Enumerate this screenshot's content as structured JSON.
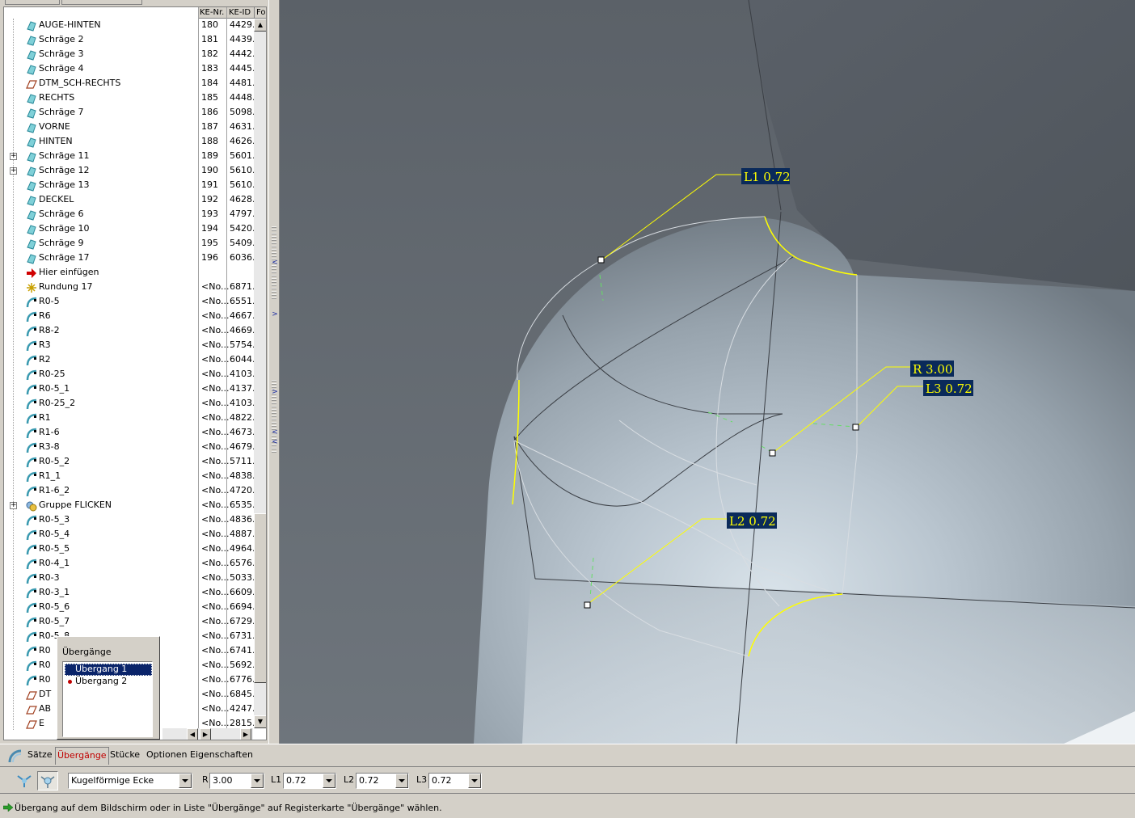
{
  "tree": {
    "columns": [
      "KE-Nr.",
      "KE-ID",
      "Fo"
    ],
    "rows": [
      {
        "label": "AUGE-HINTEN",
        "nr": "180",
        "id": "4429...",
        "icon": "extrude-icon",
        "expand": false
      },
      {
        "label": "Schräge 2",
        "nr": "181",
        "id": "4439...",
        "icon": "extrude-icon",
        "expand": false
      },
      {
        "label": "Schräge 3",
        "nr": "182",
        "id": "4442...",
        "icon": "extrude-icon",
        "expand": false
      },
      {
        "label": "Schräge 4",
        "nr": "183",
        "id": "4445...",
        "icon": "extrude-icon",
        "expand": false
      },
      {
        "label": "DTM_SCH-RECHTS",
        "nr": "184",
        "id": "4481...",
        "icon": "datum-plane-icon",
        "expand": false
      },
      {
        "label": "RECHTS",
        "nr": "185",
        "id": "4448...",
        "icon": "extrude-icon",
        "expand": false
      },
      {
        "label": "Schräge 7",
        "nr": "186",
        "id": "5098...",
        "icon": "extrude-icon",
        "expand": false
      },
      {
        "label": "VORNE",
        "nr": "187",
        "id": "4631...",
        "icon": "extrude-icon",
        "expand": false
      },
      {
        "label": "HINTEN",
        "nr": "188",
        "id": "4626...",
        "icon": "extrude-icon",
        "expand": false
      },
      {
        "label": "Schräge 11",
        "nr": "189",
        "id": "5601...",
        "icon": "extrude-icon",
        "expand": true
      },
      {
        "label": "Schräge 12",
        "nr": "190",
        "id": "5610...",
        "icon": "extrude-icon",
        "expand": true
      },
      {
        "label": "Schräge 13",
        "nr": "191",
        "id": "5610...",
        "icon": "extrude-icon",
        "expand": false
      },
      {
        "label": "DECKEL",
        "nr": "192",
        "id": "4628...",
        "icon": "extrude-icon",
        "expand": false
      },
      {
        "label": "Schräge 6",
        "nr": "193",
        "id": "4797...",
        "icon": "extrude-icon",
        "expand": false
      },
      {
        "label": "Schräge 10",
        "nr": "194",
        "id": "5420...",
        "icon": "extrude-icon",
        "expand": false
      },
      {
        "label": "Schräge 9",
        "nr": "195",
        "id": "5409...",
        "icon": "extrude-icon",
        "expand": false
      },
      {
        "label": "Schräge 17",
        "nr": "196",
        "id": "6036...",
        "icon": "extrude-icon",
        "expand": false
      },
      {
        "label": "Hier einfügen",
        "nr": "",
        "id": "",
        "icon": "insert-here-arrow-icon",
        "expand": false
      },
      {
        "label": "Rundung 17",
        "nr": "<No...",
        "id": "6871...",
        "icon": "active-round-icon",
        "expand": false
      },
      {
        "label": "R0-5",
        "nr": "<No...",
        "id": "6551...",
        "icon": "round-icon",
        "expand": false
      },
      {
        "label": "R6",
        "nr": "<No...",
        "id": "4667...",
        "icon": "round-icon",
        "expand": false
      },
      {
        "label": "R8-2",
        "nr": "<No...",
        "id": "4669...",
        "icon": "round-icon",
        "expand": false
      },
      {
        "label": "R3",
        "nr": "<No...",
        "id": "5754...",
        "icon": "round-icon",
        "expand": false
      },
      {
        "label": "R2",
        "nr": "<No...",
        "id": "6044...",
        "icon": "round-icon",
        "expand": false
      },
      {
        "label": "R0-25",
        "nr": "<No...",
        "id": "4103...",
        "icon": "round-icon",
        "expand": false
      },
      {
        "label": "R0-5_1",
        "nr": "<No...",
        "id": "4137...",
        "icon": "round-icon",
        "expand": false
      },
      {
        "label": "R0-25_2",
        "nr": "<No...",
        "id": "4103...",
        "icon": "round-icon",
        "expand": false
      },
      {
        "label": "R1",
        "nr": "<No...",
        "id": "4822...",
        "icon": "round-icon",
        "expand": false
      },
      {
        "label": "R1-6",
        "nr": "<No...",
        "id": "4673...",
        "icon": "round-icon",
        "expand": false
      },
      {
        "label": "R3-8",
        "nr": "<No...",
        "id": "4679...",
        "icon": "round-icon",
        "expand": false
      },
      {
        "label": "R0-5_2",
        "nr": "<No...",
        "id": "5711...",
        "icon": "round-icon",
        "expand": false
      },
      {
        "label": "R1_1",
        "nr": "<No...",
        "id": "4838...",
        "icon": "round-icon",
        "expand": false
      },
      {
        "label": "R1-6_2",
        "nr": "<No...",
        "id": "4720...",
        "icon": "round-icon",
        "expand": false
      },
      {
        "label": "Gruppe FLICKEN",
        "nr": "<No...",
        "id": "6535...",
        "icon": "group-icon",
        "expand": true
      },
      {
        "label": "R0-5_3",
        "nr": "<No...",
        "id": "4836...",
        "icon": "round-icon",
        "expand": false
      },
      {
        "label": "R0-5_4",
        "nr": "<No...",
        "id": "4887...",
        "icon": "round-icon",
        "expand": false
      },
      {
        "label": "R0-5_5",
        "nr": "<No...",
        "id": "4964...",
        "icon": "round-icon",
        "expand": false
      },
      {
        "label": "R0-4_1",
        "nr": "<No...",
        "id": "6576...",
        "icon": "round-icon",
        "expand": false
      },
      {
        "label": "R0-3",
        "nr": "<No...",
        "id": "5033...",
        "icon": "round-icon",
        "expand": false
      },
      {
        "label": "R0-3_1",
        "nr": "<No...",
        "id": "6609...",
        "icon": "round-icon",
        "expand": false
      },
      {
        "label": "R0-5_6",
        "nr": "<No...",
        "id": "6694...",
        "icon": "round-icon",
        "expand": false
      },
      {
        "label": "R0-5_7",
        "nr": "<No...",
        "id": "6729...",
        "icon": "round-icon",
        "expand": false
      },
      {
        "label": "R0-5_8",
        "nr": "<No...",
        "id": "6731...",
        "icon": "round-icon",
        "expand": false
      },
      {
        "label": "R0",
        "nr": "<No...",
        "id": "6741...",
        "icon": "round-icon",
        "expand": false
      },
      {
        "label": "R0",
        "nr": "<No...",
        "id": "5692...",
        "icon": "round-icon",
        "expand": false
      },
      {
        "label": "R0",
        "nr": "<No...",
        "id": "6776...",
        "icon": "round-icon",
        "expand": false
      },
      {
        "label": "DT",
        "nr": "<No...",
        "id": "6845...",
        "icon": "datum-plane-icon",
        "expand": false
      },
      {
        "label": "AB",
        "nr": "<No...",
        "id": "4247...",
        "icon": "datum-plane-icon",
        "expand": false
      },
      {
        "label": "E",
        "nr": "<No...",
        "id": "2815...",
        "icon": "datum-plane-icon",
        "expand": false
      }
    ]
  },
  "popup": {
    "title": "Übergänge",
    "items": [
      {
        "label": "Übergang 1",
        "selected": true
      },
      {
        "label": "Übergang 2",
        "selected": false
      }
    ]
  },
  "viewport": {
    "annotations": [
      {
        "text": "L1 0.72"
      },
      {
        "text": "R 3.00"
      },
      {
        "text": "L3 0.72"
      },
      {
        "text": "L2 0.72"
      }
    ],
    "colors": {
      "highlight": "#ffff00",
      "label_bg": "#0a2a5a",
      "dim_line": "#ffff00"
    }
  },
  "dashboard": {
    "tabs": [
      "Sätze",
      "Übergänge",
      "Stücke",
      "Optionen",
      "Eigenschaften"
    ],
    "active_tab": "Übergänge",
    "transition_type": "Kugelförmige Ecke",
    "fields": [
      {
        "label": "R",
        "value": "3.00"
      },
      {
        "label": "L1",
        "value": "0.72"
      },
      {
        "label": "L2",
        "value": "0.72"
      },
      {
        "label": "L3",
        "value": "0.72"
      }
    ]
  },
  "status": {
    "message": "Übergang auf dem Bildschirm oder in Liste \"Übergänge\" auf Registerkarte \"Übergänge\" wählen."
  }
}
